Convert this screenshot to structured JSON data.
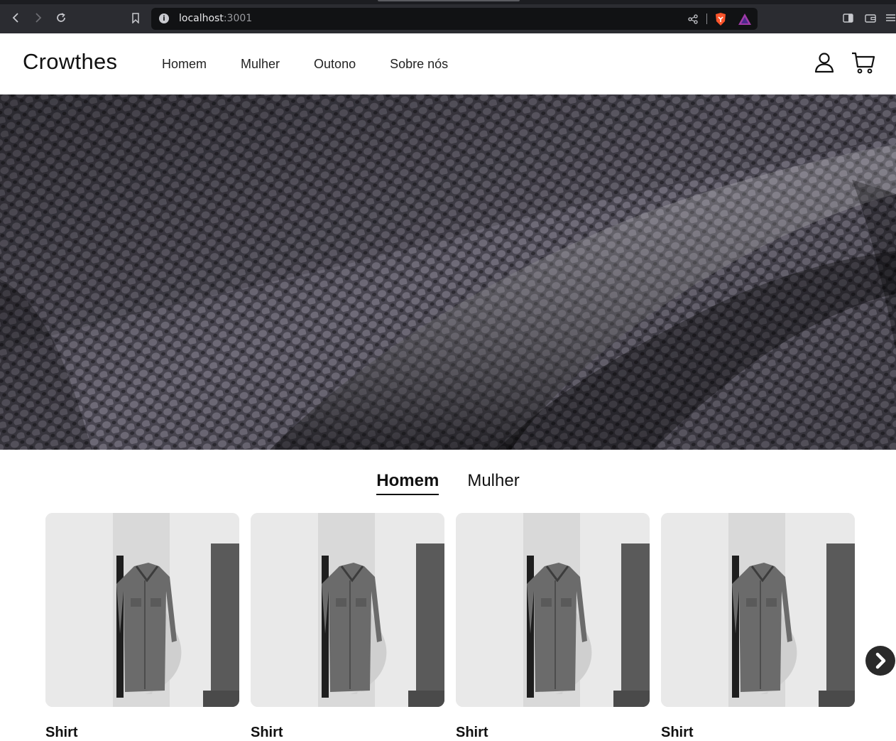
{
  "browser": {
    "url_host": "localhost",
    "url_port": ":3001",
    "icons": [
      "back-icon",
      "forward-icon",
      "reload-icon",
      "bookmark-icon",
      "site-info-icon",
      "share-icon",
      "brave-shield-icon",
      "brave-rewards-icon",
      "sidebar-icon",
      "wallet-icon",
      "menu-icon"
    ]
  },
  "header": {
    "logo": "Crowthes",
    "nav": [
      "Homem",
      "Mulher",
      "Outono",
      "Sobre nós"
    ],
    "icons": [
      "user-icon",
      "cart-icon"
    ]
  },
  "tabs": [
    {
      "label": "Homem",
      "active": true
    },
    {
      "label": "Mulher",
      "active": false
    }
  ],
  "products": [
    {
      "title": "Shirt"
    },
    {
      "title": "Shirt"
    },
    {
      "title": "Shirt"
    },
    {
      "title": "Shirt"
    }
  ],
  "carousel": {
    "next_icon": "chevron-right-icon"
  },
  "colors": {
    "accent": "#111111",
    "hero": "#3d3b43",
    "chrome": "#2b2c31"
  }
}
